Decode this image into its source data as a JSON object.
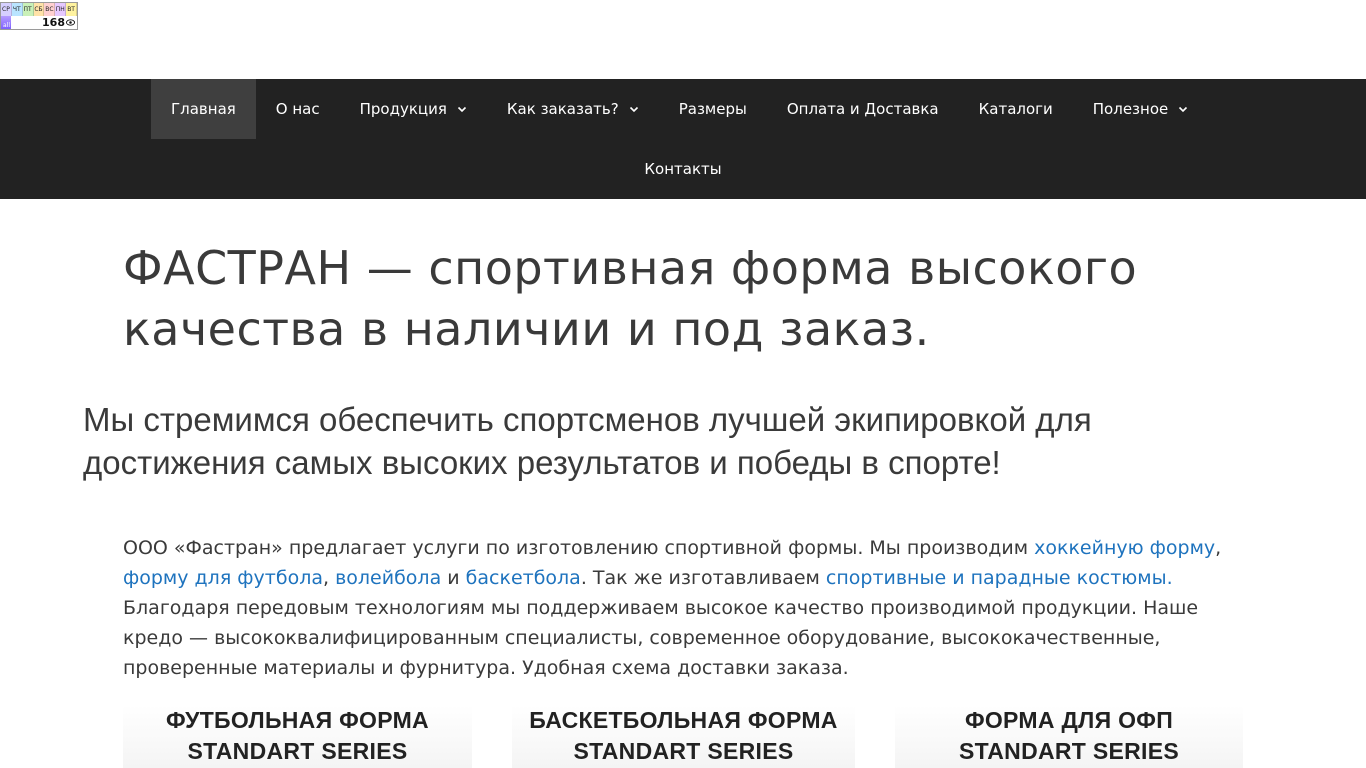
{
  "counter": {
    "days": [
      "СР",
      "ЧТ",
      "ПТ",
      "СБ",
      "ВС",
      "ПН",
      "ВТ"
    ],
    "bar_label": "all",
    "value": "168",
    "icon": "eye-icon"
  },
  "nav": {
    "items": [
      {
        "label": "Главная",
        "active": true
      },
      {
        "label": "О нас"
      },
      {
        "label": "Продукция",
        "dropdown": true
      },
      {
        "label": "Как заказать?",
        "dropdown": true
      },
      {
        "label": "Размеры"
      },
      {
        "label": "Оплата и Доставка"
      },
      {
        "label": "Каталоги"
      },
      {
        "label": "Полезное",
        "dropdown": true
      }
    ],
    "second_row": [
      {
        "label": "Контакты"
      }
    ]
  },
  "main": {
    "title": "ФАСТРАН — спортивная форма высокого качества в наличии и под заказ.",
    "subtitle": "Мы стремимся обеспечить спортсменов лучшей экипировкой для достижения самых высоких результатов и победы в спорте!",
    "intro": {
      "t1": "ООО «Фастран» предлагает услуги по изготовлению спортивной формы. Мы производим ",
      "link_hockey": "хоккейную форму",
      "t2": ", ",
      "link_football": "форму для футбола",
      "t3": ", ",
      "link_volleyball": "волейбола",
      "t4": " и ",
      "link_basketball": "баскетбола",
      "t5": ". Так же изготавливаем ",
      "link_suits": "спортивные и парадные костюмы.",
      "t6": " Благодаря передовым технологиям мы поддерживаем высокое качество производимой продукции. Наше кредо — высококвалифицированным специалисты, современное оборудование, высококачественные, проверенные материалы и фурнитура. Удобная схема доставки заказа."
    }
  },
  "cards": [
    {
      "line1": "ФУТБОЛЬНАЯ ФОРМА",
      "line2": "STANDART SERIES"
    },
    {
      "line1": "БАСКЕТБОЛЬНАЯ ФОРМА",
      "line2": "STANDART SERIES"
    },
    {
      "line1": "ФОРМА ДЛЯ ОФП",
      "line2": "STANDART SERIES"
    }
  ],
  "colors": {
    "nav_bg": "#222222",
    "nav_active_bg": "#3f3f3f",
    "link": "#1e73be",
    "text": "#3a3a3a"
  }
}
